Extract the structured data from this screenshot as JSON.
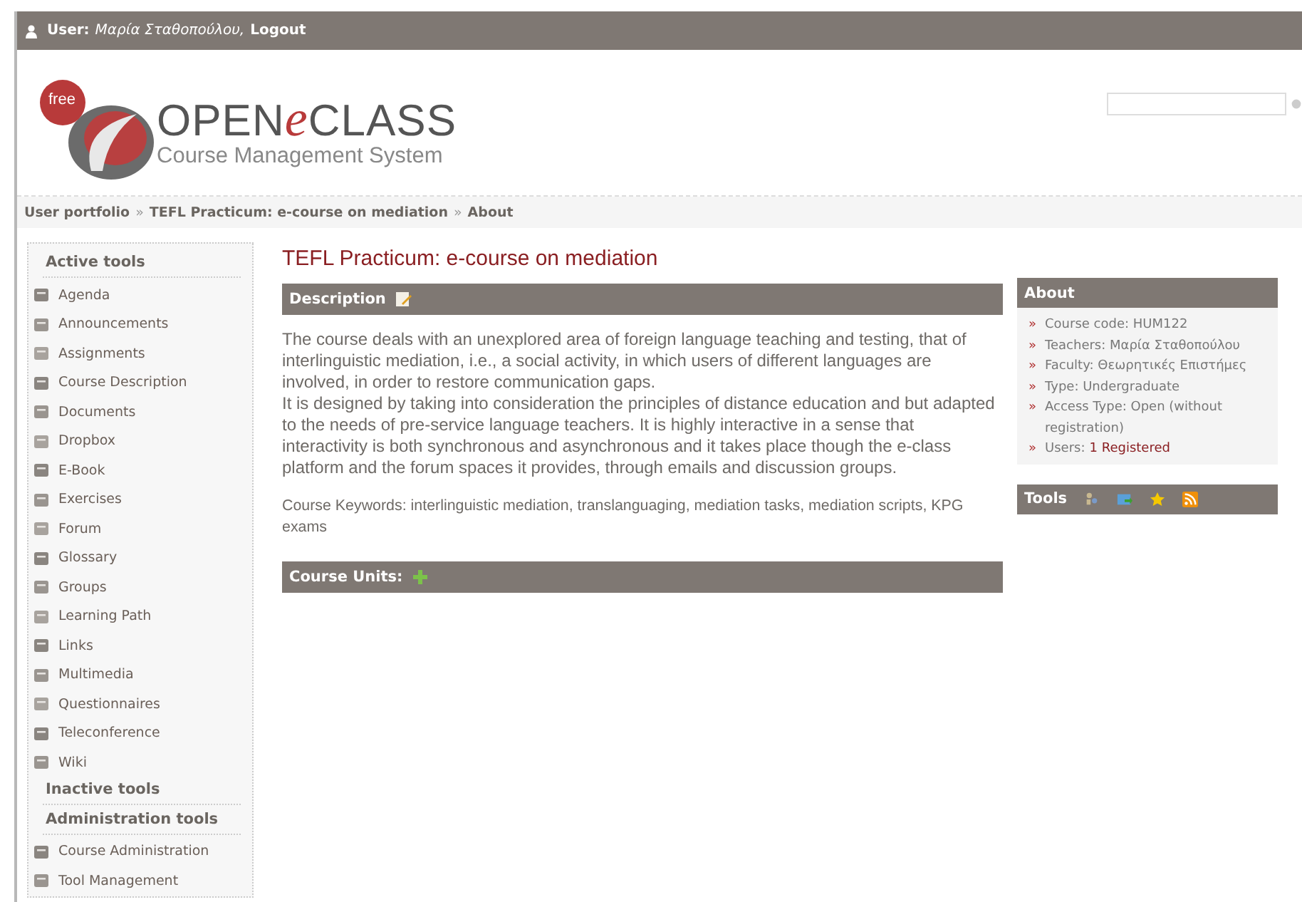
{
  "user_bar": {
    "label": "User:",
    "name": "Μαρία Σταθοπούλου,",
    "logout": "Logout"
  },
  "logo": {
    "badge": "free",
    "brand_start": "OPEN",
    "brand_e": "e",
    "brand_end": "CLASS",
    "tagline": "Course Management System"
  },
  "breadcrumb": {
    "separator": "»",
    "items": [
      "User portfolio",
      "TEFL Practicum: e-course on mediation",
      "About"
    ]
  },
  "sidebar": [
    {
      "title": "Active tools",
      "items": [
        "Agenda",
        "Announcements",
        "Assignments",
        "Course Description",
        "Documents",
        "Dropbox",
        "E-Book",
        "Exercises",
        "Forum",
        "Glossary",
        "Groups",
        "Learning Path",
        "Links",
        "Multimedia",
        "Questionnaires",
        "Teleconference",
        "Wiki"
      ]
    },
    {
      "title": "Inactive tools"
    },
    {
      "title": "Administration tools",
      "items": [
        "Course Administration",
        "Tool Management"
      ]
    }
  ],
  "course_title": "TEFL Practicum: e-course on mediation",
  "description": {
    "heading": "Description",
    "paragraphs": [
      "The course deals with an unexplored area of foreign language teaching and testing, that of interlinguistic mediation, i.e., a social activity, in which users of different languages are involved, in order to restore communication gaps.",
      "It is designed by taking into consideration the principles of distance education and but adapted to the needs of pre-service language teachers. It is highly interactive in a sense that interactivity is both synchronous and asynchronous and it takes place though the e-class platform and the forum spaces it provides, through emails and discussion groups."
    ],
    "keywords": "Course Keywords: interlinguistic mediation, translanguaging, mediation tasks, mediation scripts, KPG exams"
  },
  "course_units": {
    "heading": "Course Units:"
  },
  "about": {
    "heading": "About",
    "bullet": "»",
    "items": [
      {
        "text": "Course code: HUM122"
      },
      {
        "text": "Teachers: Μαρία Σταθοπούλου"
      },
      {
        "text": "Faculty: Θεωρητικές Επιστήμες"
      },
      {
        "text": "Type: Undergraduate"
      },
      {
        "text": "Access Type: Open (without registration)"
      },
      {
        "text": "Users:",
        "link": "1 Registered"
      }
    ]
  },
  "tools": {
    "heading": "Tools"
  }
}
